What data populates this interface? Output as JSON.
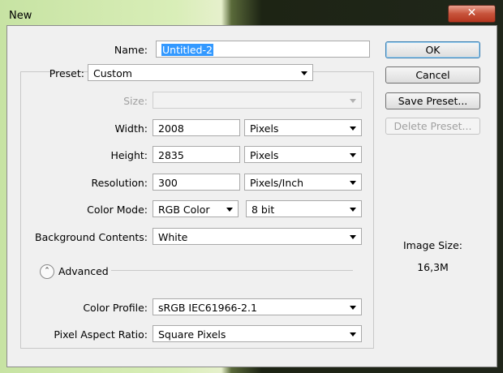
{
  "window": {
    "title": "New",
    "close_glyph": "✕"
  },
  "name": {
    "label": "Name:",
    "value": "Untitled-2"
  },
  "preset": {
    "label": "Preset:",
    "value": "Custom"
  },
  "size": {
    "label": "Size:",
    "value": ""
  },
  "width": {
    "label": "Width:",
    "value": "2008",
    "unit": "Pixels"
  },
  "height": {
    "label": "Height:",
    "value": "2835",
    "unit": "Pixels"
  },
  "resolution": {
    "label": "Resolution:",
    "value": "300",
    "unit": "Pixels/Inch"
  },
  "color_mode": {
    "label": "Color Mode:",
    "value": "RGB Color",
    "depth": "8 bit"
  },
  "background_contents": {
    "label": "Background Contents:",
    "value": "White"
  },
  "advanced": {
    "label": "Advanced",
    "toggle_glyph": "⌃"
  },
  "color_profile": {
    "label": "Color Profile:",
    "value": "sRGB IEC61966-2.1"
  },
  "pixel_aspect_ratio": {
    "label": "Pixel Aspect Ratio:",
    "value": "Square Pixels"
  },
  "buttons": {
    "ok": "OK",
    "cancel": "Cancel",
    "save_preset": "Save Preset...",
    "delete_preset": "Delete Preset..."
  },
  "image_size": {
    "label": "Image Size:",
    "value": "16,3M"
  },
  "colors": {
    "selection": "#3399ff",
    "close_button": "#c7533b",
    "dialog_bg": "#f0f0f0"
  }
}
